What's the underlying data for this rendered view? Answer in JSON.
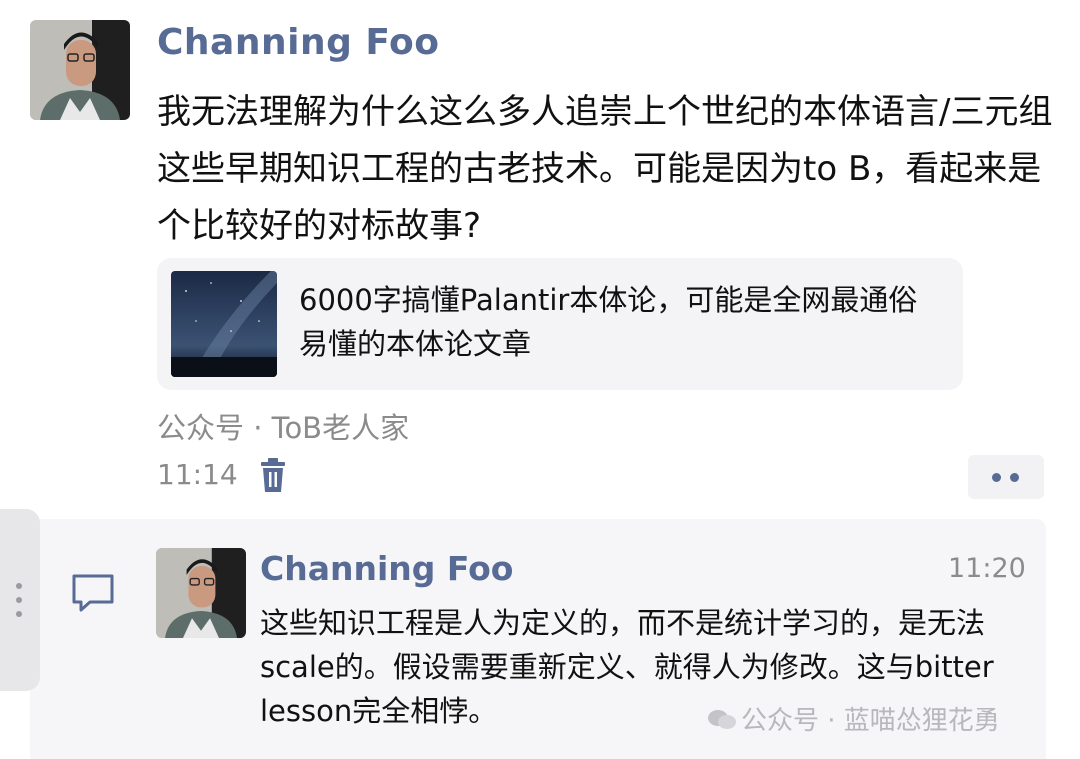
{
  "post": {
    "author": "Channing Foo",
    "text": "我无法理解为什么这么多人追崇上个世纪的本体语言/三元组这些早期知识工程的古老技术。可能是因为to B，看起来是个比较好的对标故事?",
    "link_card": {
      "title": "6000字搞懂Palantir本体论，可能是全网最通俗易懂的本体论文章",
      "thumbnail": "starry-night-sky"
    },
    "source": "公众号 · ToB老人家",
    "time": "11:14",
    "icons": {
      "delete": "trash-icon",
      "more": "more-dots-icon"
    }
  },
  "comment": {
    "author": "Channing Foo",
    "time": "11:20",
    "text": "这些知识工程是人为定义的，而不是统计学习的，是无法scale的。假设需要重新定义、就得人为修改。这与bitter lesson完全相悖。",
    "icon": "comment-bubble-icon"
  },
  "watermark": {
    "text": "公众号 · 蓝喵怂狸花勇"
  },
  "colors": {
    "author_name": "#576b95",
    "meta_text": "#8b8b8b",
    "card_background": "#f4f4f6",
    "comment_background": "#f6f6f8"
  }
}
